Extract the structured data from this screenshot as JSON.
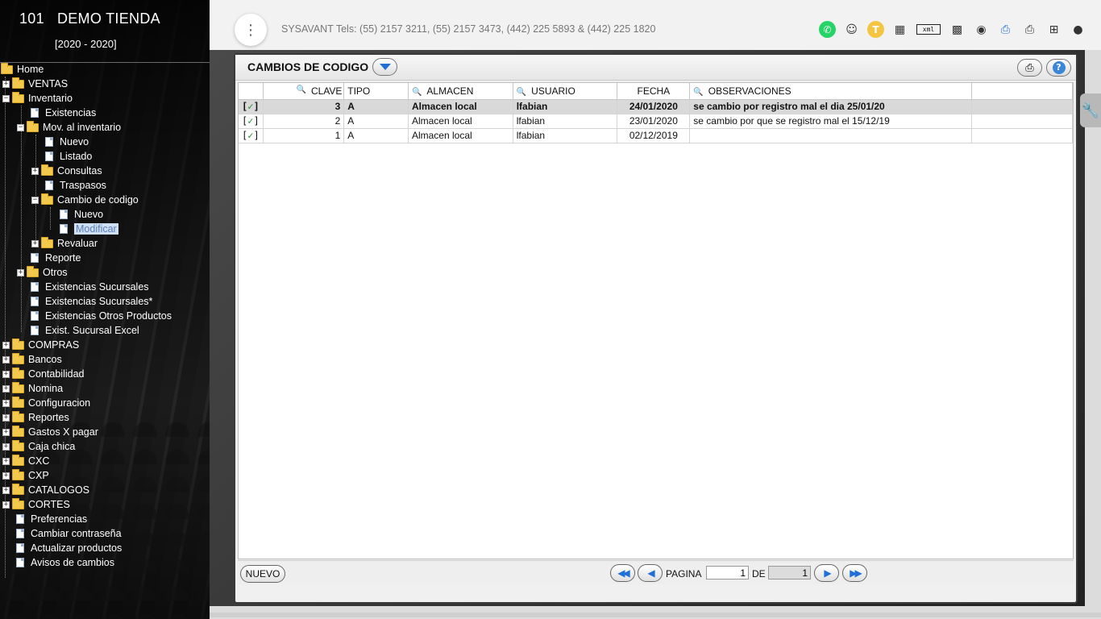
{
  "sidebar": {
    "company_code": "101",
    "company_name": "DEMO TIENDA",
    "period": "[2020 - 2020]",
    "tree": [
      {
        "label": "Home"
      },
      {
        "label": "VENTAS"
      },
      {
        "label": "Inventario"
      },
      {
        "label": "Existencias"
      },
      {
        "label": "Mov. al inventario"
      },
      {
        "label": "Nuevo"
      },
      {
        "label": "Listado"
      },
      {
        "label": "Consultas"
      },
      {
        "label": "Traspasos"
      },
      {
        "label": "Cambio de codigo"
      },
      {
        "label": "Nuevo"
      },
      {
        "label": "Modificar"
      },
      {
        "label": "Revaluar"
      },
      {
        "label": "Reporte"
      },
      {
        "label": "Otros"
      },
      {
        "label": "Existencias Sucursales"
      },
      {
        "label": "Existencias Sucursales*"
      },
      {
        "label": "Existencias Otros Productos"
      },
      {
        "label": "Exist. Sucursal Excel"
      },
      {
        "label": "COMPRAS"
      },
      {
        "label": "Bancos"
      },
      {
        "label": "Contabilidad"
      },
      {
        "label": "Nomina"
      },
      {
        "label": "Configuracion"
      },
      {
        "label": "Reportes"
      },
      {
        "label": "Gastos X pagar"
      },
      {
        "label": "Caja chica"
      },
      {
        "label": "CXC"
      },
      {
        "label": "CXP"
      },
      {
        "label": "CATALOGOS"
      },
      {
        "label": "CORTES"
      },
      {
        "label": "Preferencias"
      },
      {
        "label": "Cambiar contraseña"
      },
      {
        "label": "Actualizar productos"
      },
      {
        "label": "Avisos de cambios"
      }
    ]
  },
  "topbar": {
    "contact": "SYSAVANT Tels: (55) 2157 3211, (55) 2157 3473, (442) 225 5893 & (442) 225 1820",
    "icons": [
      "whatsapp-icon",
      "support-icon",
      "token-icon",
      "dashboard-icon",
      "xml-icon",
      "qr-icon",
      "settings-icon",
      "invoice-search-icon",
      "print-icon",
      "new-window-icon",
      "user-icon"
    ],
    "token_letter": "T",
    "xml_label": "xml"
  },
  "panel": {
    "title": "CAMBIOS DE CODIGO",
    "columns": [
      "",
      "CLAVE",
      "TIPO",
      "ALMACEN",
      "USUARIO",
      "FECHA",
      "OBSERVACIONES",
      ""
    ],
    "rows": [
      {
        "check": "[",
        "mark": "✓",
        "close": "]",
        "clave": "3",
        "tipo": "A",
        "almacen": "Almacen local",
        "usuario": "lfabian",
        "fecha": "24/01/2020",
        "obs": "se cambio por registro mal el dia 25/01/20"
      },
      {
        "check": "[",
        "mark": "✓",
        "close": "]",
        "clave": "2",
        "tipo": "A",
        "almacen": "Almacen local",
        "usuario": "lfabian",
        "fecha": "23/01/2020",
        "obs": "se cambio por que se registro mal el 15/12/19"
      },
      {
        "check": "[",
        "mark": "✓",
        "close": "]",
        "clave": "1",
        "tipo": "A",
        "almacen": "Almacen local",
        "usuario": "lfabian",
        "fecha": "02/12/2019",
        "obs": ""
      }
    ],
    "footer": {
      "nuevo_label": "NUEVO",
      "pagina_label": "PAGINA",
      "page": "1",
      "de_label": "DE",
      "total_pages": "1"
    }
  },
  "colors": {
    "accent_blue": "#1f6fd6",
    "check_green": "#1e8c2c",
    "selected_row": "#d9d9d9",
    "folder_yellow": "#f2c94c"
  }
}
